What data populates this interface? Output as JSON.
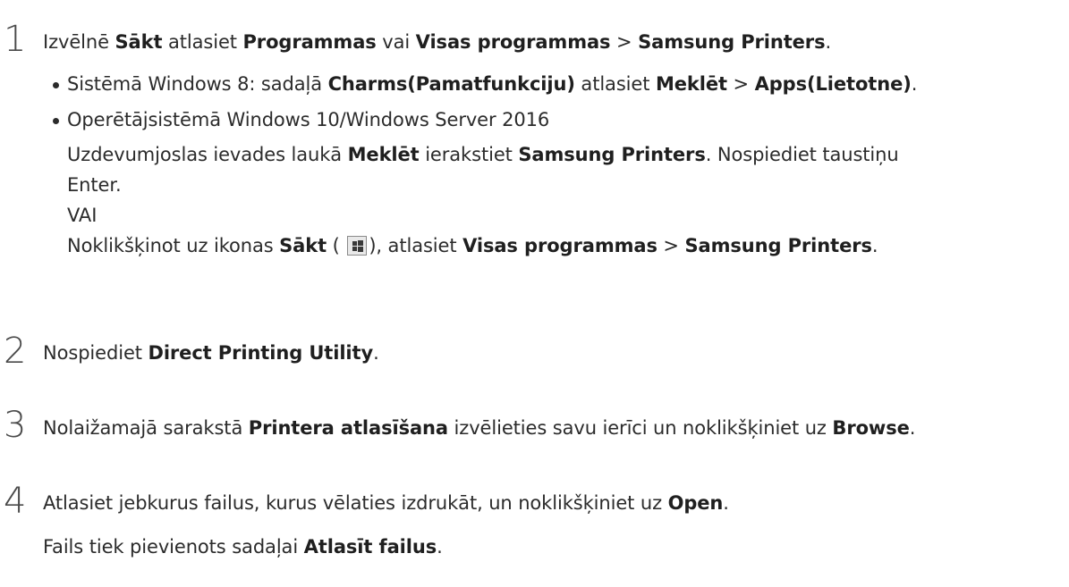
{
  "steps": [
    {
      "number": "1",
      "main": {
        "t1": "Izvēlnē ",
        "b1": "Sākt",
        "t2": " atlasiet ",
        "b2": "Programmas",
        "t3": " vai ",
        "b3": "Visas programmas",
        "t4": " > ",
        "b4": "Samsung Printers",
        "t5": "."
      },
      "bullet1": {
        "t1": "Sistēmā Windows 8: sadaļā ",
        "b1": "Charms(Pamatfunkciju)",
        "t2": " atlasiet ",
        "b2": "Meklēt",
        "t3": " > ",
        "b3": "Apps(Lietotne)",
        "t4": "."
      },
      "bullet2": {
        "line1": "Operētājsistēmā Windows 10/Windows Server 2016",
        "line2": {
          "t1": "Uzdevumjoslas ievades laukā ",
          "b1": "Meklēt",
          "t2": " ierakstiet ",
          "b2": "Samsung Printers",
          "t3": ". Nospiediet taustiņu"
        },
        "line3": "Enter.",
        "line4": "VAI",
        "line5": {
          "t1": "Noklikšķinot uz ikonas ",
          "b1": "Sākt",
          "t2": " (",
          "t3": "), atlasiet ",
          "b2": "Visas programmas",
          "t4": " > ",
          "b3": "Samsung Printers",
          "t5": "."
        }
      }
    },
    {
      "number": "2",
      "main": {
        "t1": "Nospiediet ",
        "b1": "Direct Printing Utility",
        "t2": "."
      }
    },
    {
      "number": "3",
      "main": {
        "t1": "Nolaižamajā sarakstā ",
        "b1": "Printera atlasīšana",
        "t2": " izvēlieties savu ierīci un noklikšķiniet uz ",
        "b2": "Browse",
        "t3": "."
      }
    },
    {
      "number": "4",
      "main": {
        "t1": "Atlasiet jebkurus failus, kurus vēlaties izdrukāt, un noklikšķiniet uz ",
        "b1": "Open",
        "t2": "."
      },
      "note": {
        "t1": "Fails tiek pievienots sadaļai ",
        "b1": "Atlasīt failus",
        "t2": "."
      }
    }
  ],
  "icons": {
    "start_button_icon": "windows-logo-icon"
  }
}
